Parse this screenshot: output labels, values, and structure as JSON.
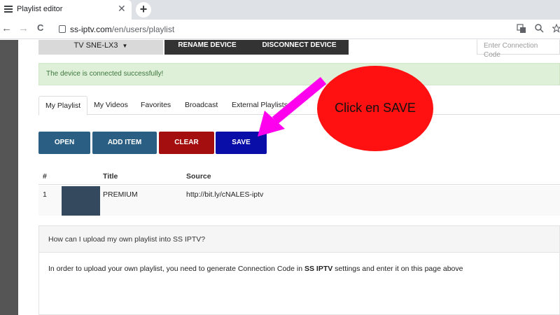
{
  "browser": {
    "tab_title": "Playlist editor",
    "tab_close": "✕",
    "new_tab": "+",
    "url_host": "ss-iptv.com",
    "url_path": "/en/users/playlist",
    "back": "←",
    "forward": "→",
    "reload": "C"
  },
  "header": {
    "device_name": "TV SNE-LX3",
    "device_caret": "▼",
    "rename_label": "RENAME DEVICE",
    "disconnect_label": "DISCONNECT DEVICE",
    "connection_placeholder": "Enter Connection Code"
  },
  "alert": {
    "message": "The device is connected successfully!"
  },
  "tabs": [
    "My Playlist",
    "My Videos",
    "Favorites",
    "Broadcast",
    "External Playlists"
  ],
  "actions": {
    "open": "OPEN",
    "add_item": "ADD ITEM",
    "clear": "CLEAR",
    "save": "SAVE",
    "colors": {
      "open": "#2a5f83",
      "add_item": "#2a5f83",
      "clear": "#a50e0e",
      "save": "#0a0ea8"
    }
  },
  "table": {
    "columns": [
      "#",
      "Title",
      "Source"
    ],
    "rows": [
      {
        "index": "1",
        "title": "PREMIUM",
        "source": "http://bit.ly/cNALES-iptv"
      }
    ]
  },
  "faq": {
    "question": "How can I upload my own playlist into SS IPTV?",
    "answer_before": "In order to upload your own playlist, you need to generate Connection Code in ",
    "answer_bold": "SS IPTV",
    "answer_after": " settings and enter it on this page above"
  },
  "annotation": {
    "text": "Click en SAVE",
    "bubble_color": "#ff1111",
    "arrow_color": "#ff00ee"
  }
}
